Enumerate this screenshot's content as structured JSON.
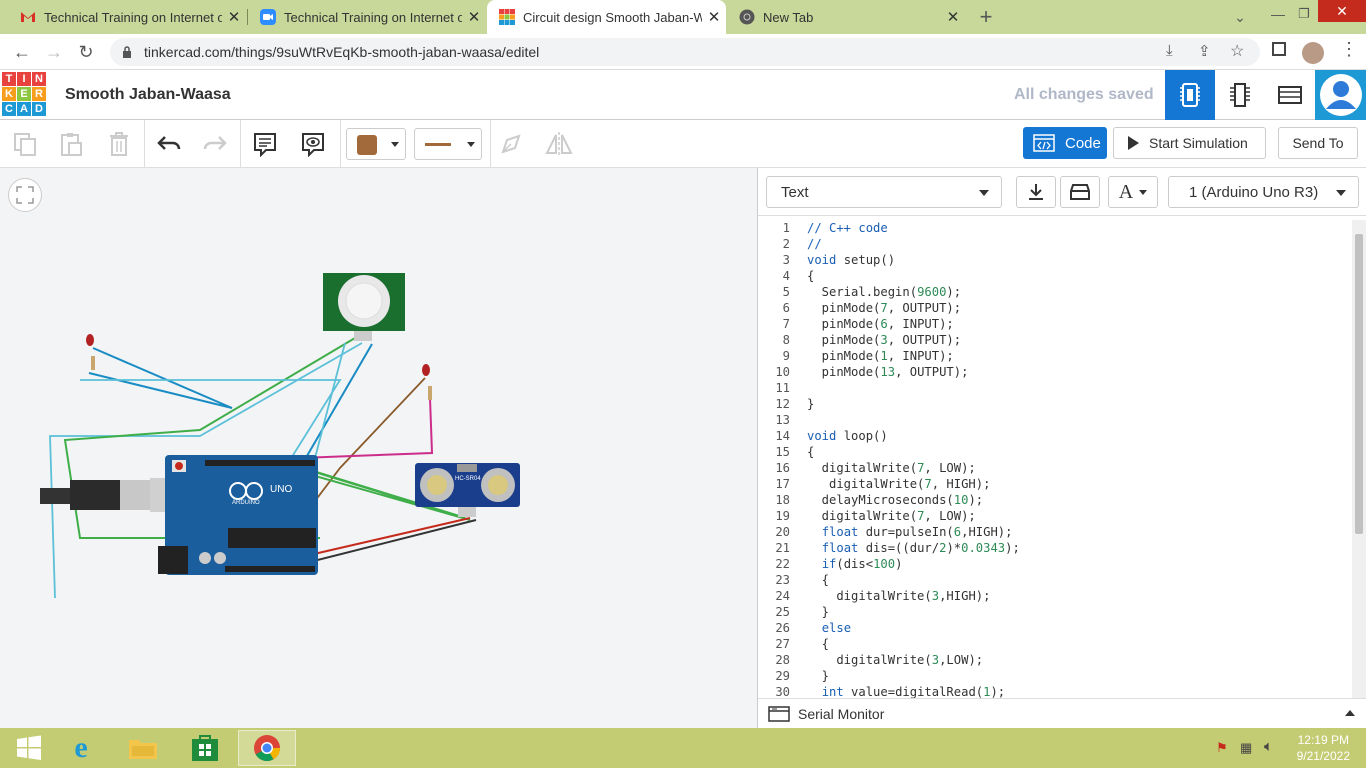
{
  "browser": {
    "tabs": [
      {
        "title": "Technical Training on Internet of",
        "icon": "gmail-icon"
      },
      {
        "title": "Technical Training on Internet of",
        "icon": "zoom-icon"
      },
      {
        "title": "Circuit design Smooth Jaban-Wa",
        "icon": "tinkercad-icon"
      },
      {
        "title": "New Tab",
        "icon": "chrome-icon"
      }
    ],
    "url": "tinkercad.com/things/9suWtRvEqKb-smooth-jaban-waasa/editel"
  },
  "app": {
    "logo_letters": [
      "T",
      "I",
      "N",
      "K",
      "E",
      "R",
      "C",
      "A",
      "D"
    ],
    "title": "Smooth Jaban-Waasa",
    "save_status": "All changes saved"
  },
  "toolbar": {
    "code_label": "Code",
    "start_sim_label": "Start Simulation",
    "send_to_label": "Send To"
  },
  "code_panel": {
    "mode": "Text",
    "device": "1 (Arduino Uno R3)",
    "serial_monitor": "Serial Monitor"
  },
  "code_lines": [
    "// C++ code",
    "//",
    "void setup()",
    "{",
    "  Serial.begin(9600);",
    "  pinMode(7, OUTPUT);",
    "  pinMode(6, INPUT);",
    "  pinMode(3, OUTPUT);",
    "  pinMode(1, INPUT);",
    "  pinMode(13, OUTPUT);",
    "",
    "}",
    "",
    "void loop()",
    "{",
    "  digitalWrite(7, LOW);",
    "   digitalWrite(7, HIGH);",
    "  delayMicroseconds(10);",
    "  digitalWrite(7, LOW);",
    "  float dur=pulseIn(6,HIGH);",
    "  float dis=((dur/2)*0.0343);",
    "  if(dis<100)",
    "  {",
    "    digitalWrite(3,HIGH);",
    "  }",
    "  else",
    "  {",
    "    digitalWrite(3,LOW);",
    "  }",
    "  int value=digitalRead(1);"
  ],
  "circuit": {
    "sensor_label": "HC-SR04",
    "board_label": "UNO",
    "board_brand": "ARDUINO"
  },
  "taskbar": {
    "time": "12:19 PM",
    "date": "9/21/2022"
  },
  "colors": {
    "tab_bar": "#c8d79a",
    "accent": "#1477d4",
    "taskbar": "#c4cc73"
  }
}
